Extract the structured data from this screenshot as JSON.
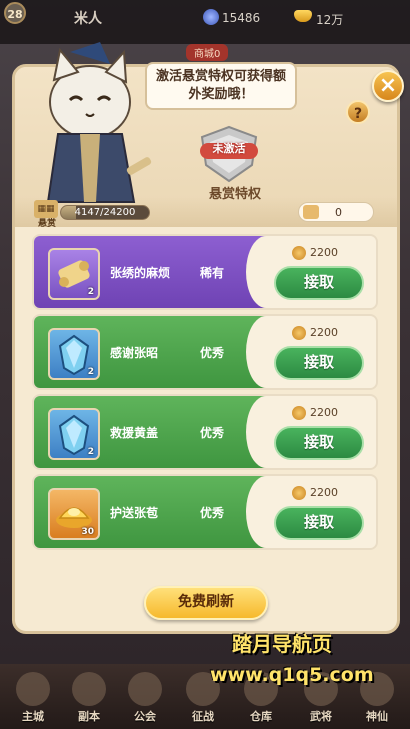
{
  "topbar": {
    "level": "28",
    "player_name": "米人",
    "coins": "15486",
    "gold": "12万",
    "rank_badge": "商城0"
  },
  "header": {
    "speech": "激活悬赏特权可获得额外奖励哦！",
    "privilege_status": "未激活",
    "privilege_title": "悬赏特权",
    "score_icon_label": "悬赏",
    "score_progress": "4147/24200",
    "score_fraction": 0.171,
    "ticket_count": "0"
  },
  "quests": [
    {
      "name": "张绣的麻烦",
      "rarity": "稀有",
      "count": "2",
      "cost": "2200",
      "button": "接取",
      "theme": "purple",
      "item_icon": "scroll-icon"
    },
    {
      "name": "感谢张昭",
      "rarity": "优秀",
      "count": "2",
      "cost": "2200",
      "button": "接取",
      "theme": "green",
      "item_icon": "blue-gem-icon"
    },
    {
      "name": "救援黄盖",
      "rarity": "优秀",
      "count": "2",
      "cost": "2200",
      "button": "接取",
      "theme": "green",
      "item_icon": "blue-gem-icon"
    },
    {
      "name": "护送张苞",
      "rarity": "优秀",
      "count": "30",
      "cost": "2200",
      "button": "接取",
      "theme": "green",
      "item_icon": "gold-ingot-icon"
    }
  ],
  "refresh_button": "免费刷新",
  "nav": [
    "主城",
    "副本",
    "公会",
    "征战",
    "仓库",
    "武将",
    "神仙"
  ],
  "watermark": {
    "line1": "踏月导航页",
    "line2": "www.q1q5.com"
  },
  "colors": {
    "purple_card": "#7f52c6",
    "green_card": "#4fa64f",
    "accept_green": "#3a9f50",
    "refresh_yellow": "#f7c43f",
    "panel": "#f6ead2"
  }
}
